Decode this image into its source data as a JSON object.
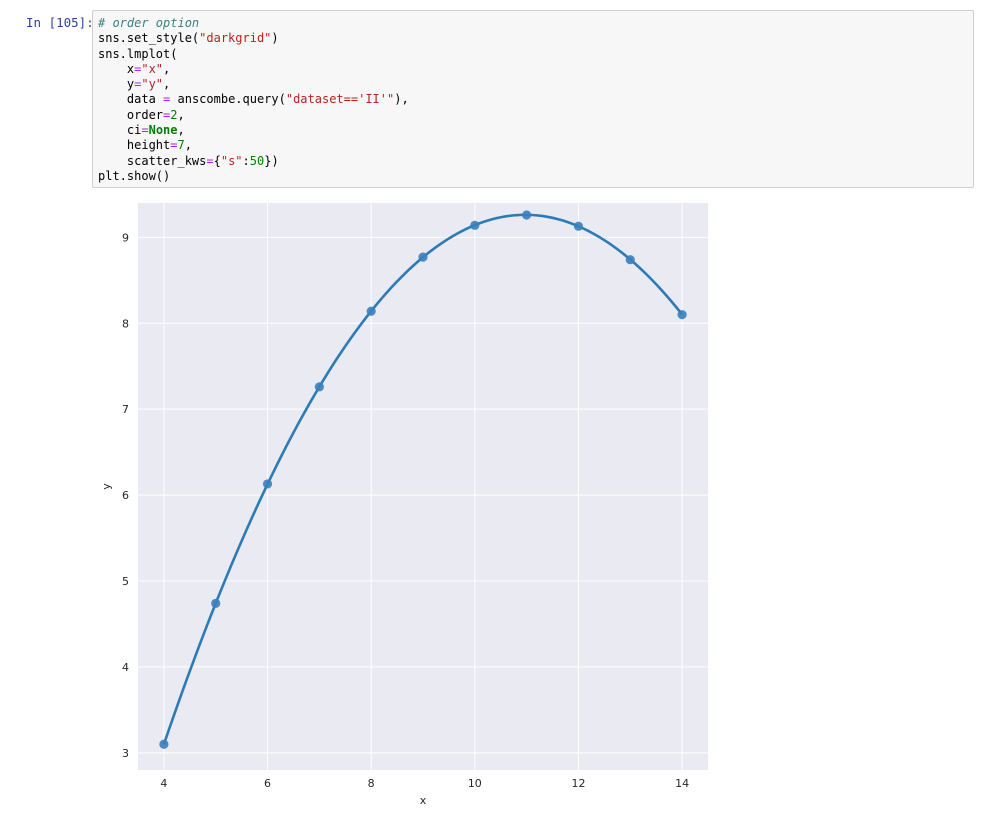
{
  "cell": {
    "prompt": "In [105]:",
    "code": [
      [
        [
          "cm",
          "# order option"
        ]
      ],
      [
        [
          "",
          "sns.set_style("
        ],
        [
          "st",
          "\"darkgrid\""
        ],
        [
          "",
          ")"
        ]
      ],
      [
        [
          "",
          "sns.lmplot("
        ]
      ],
      [
        [
          "",
          "    x"
        ],
        [
          "op",
          "="
        ],
        [
          "st",
          "\"x\""
        ],
        [
          "",
          ","
        ]
      ],
      [
        [
          "",
          "    y"
        ],
        [
          "op",
          "="
        ],
        [
          "st",
          "\"y\""
        ],
        [
          "",
          ","
        ]
      ],
      [
        [
          "",
          "    data "
        ],
        [
          "op",
          "="
        ],
        [
          "",
          " anscombe.query("
        ],
        [
          "st",
          "\"dataset=='II'\""
        ],
        [
          "",
          "),"
        ]
      ],
      [
        [
          "",
          "    order"
        ],
        [
          "op",
          "="
        ],
        [
          "nu",
          "2"
        ],
        [
          "",
          ","
        ]
      ],
      [
        [
          "",
          "    ci"
        ],
        [
          "op",
          "="
        ],
        [
          "kw",
          "None"
        ],
        [
          "",
          ","
        ]
      ],
      [
        [
          "",
          "    height"
        ],
        [
          "op",
          "="
        ],
        [
          "nu",
          "7"
        ],
        [
          "",
          ","
        ]
      ],
      [
        [
          "",
          "    scatter_kws"
        ],
        [
          "op",
          "="
        ],
        [
          "",
          "{"
        ],
        [
          "st",
          "\"s\""
        ],
        [
          "",
          ":"
        ],
        [
          "nu",
          "50"
        ],
        [
          "",
          "})"
        ]
      ],
      [
        [
          "",
          "plt.show()"
        ]
      ]
    ]
  },
  "colors": {
    "plot_bg": "#eaeaf2",
    "grid": "#ffffff",
    "series": "#2c7bb6",
    "marker": "#3a80bb"
  },
  "chart_data": {
    "type": "scatter",
    "style": "darkgrid",
    "xlabel": "x",
    "ylabel": "y",
    "xlim": [
      3.5,
      14.5
    ],
    "ylim": [
      2.8,
      9.4
    ],
    "xticks": [
      4,
      6,
      8,
      10,
      12,
      14
    ],
    "yticks": [
      3,
      4,
      5,
      6,
      7,
      8,
      9
    ],
    "grid": true,
    "points": {
      "x": [
        4,
        5,
        6,
        7,
        8,
        9,
        10,
        11,
        12,
        13,
        14
      ],
      "y": [
        3.1,
        4.74,
        6.13,
        7.26,
        8.14,
        8.77,
        9.14,
        9.26,
        9.13,
        8.74,
        8.1
      ]
    },
    "fit": {
      "order": 2,
      "coefficients": [
        -5.9957,
        2.7808,
        -0.1267
      ]
    }
  }
}
